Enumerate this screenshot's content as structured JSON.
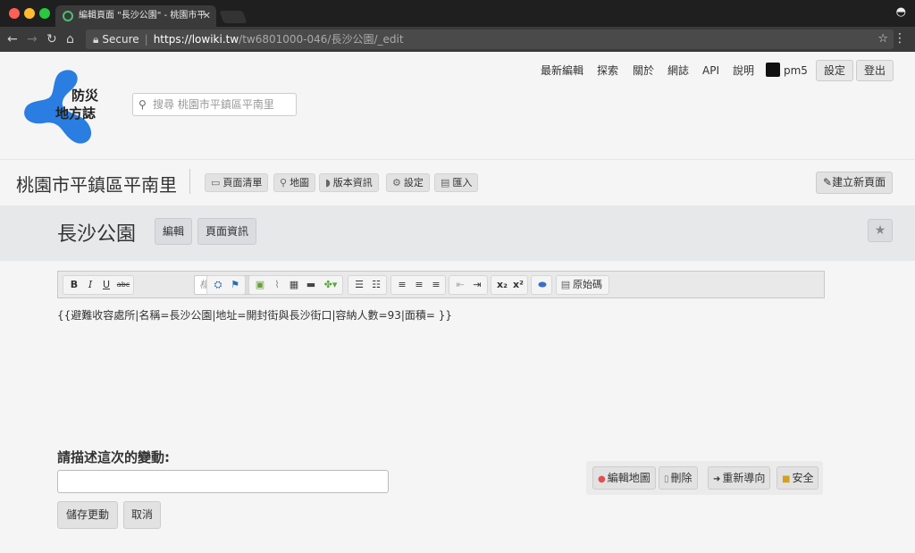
{
  "browser": {
    "tab_title": "編輯頁面 \"長沙公園\" - 桃園市平",
    "url_secure": "Secure",
    "url_host": "https://lowiki.tw",
    "url_path": "/tw6801000-046/長沙公園/_edit"
  },
  "site": {
    "logo_line1": "防災",
    "logo_line2": "地方誌",
    "search_placeholder": "搜尋 桃園市平鎮區平南里",
    "nav": [
      "最新編輯",
      "探索",
      "關於",
      "網誌",
      "API",
      "說明"
    ],
    "user": "pm5",
    "settings_label": "設定",
    "logout_label": "登出"
  },
  "region": {
    "title": "桃園市平鎮區平南里",
    "pills": [
      {
        "icon": "bus-icon",
        "glyph": "▭",
        "label": "頁面清單"
      },
      {
        "icon": "map-pin-icon",
        "glyph": "⚲",
        "label": "地圖"
      },
      {
        "icon": "rss-icon",
        "glyph": "◗",
        "label": "版本資訊"
      },
      {
        "icon": "gear-icon",
        "glyph": "⚙",
        "label": "設定"
      },
      {
        "icon": "table-icon",
        "glyph": "▤",
        "label": "匯入"
      }
    ],
    "new_page_label": "建立新頁面"
  },
  "page": {
    "title": "長沙公園",
    "edit_label": "編輯",
    "info_label": "頁面資訊"
  },
  "editor": {
    "style_placeholder": "樣式",
    "source_label": "原始碼",
    "content": "{{避難收容處所|名稱=長沙公園|地址=開封街與長沙街口|容納人數=93|面積= }}"
  },
  "summary": {
    "label": "請描述這次的變動:",
    "value": "",
    "save_label": "儲存更動",
    "cancel_label": "取消"
  },
  "actions": [
    {
      "icon": "map-pin-icon",
      "glyph": "●",
      "color": "#e05050",
      "label": "編輯地圖"
    },
    {
      "icon": "trash-icon",
      "glyph": "▯",
      "color": "#777777",
      "label": "刪除"
    },
    {
      "icon": "redirect-icon",
      "glyph": "➜",
      "color": "#333333",
      "label": "重新導向"
    },
    {
      "icon": "lock-icon",
      "glyph": "■",
      "color": "#d4a020",
      "label": "安全"
    }
  ]
}
